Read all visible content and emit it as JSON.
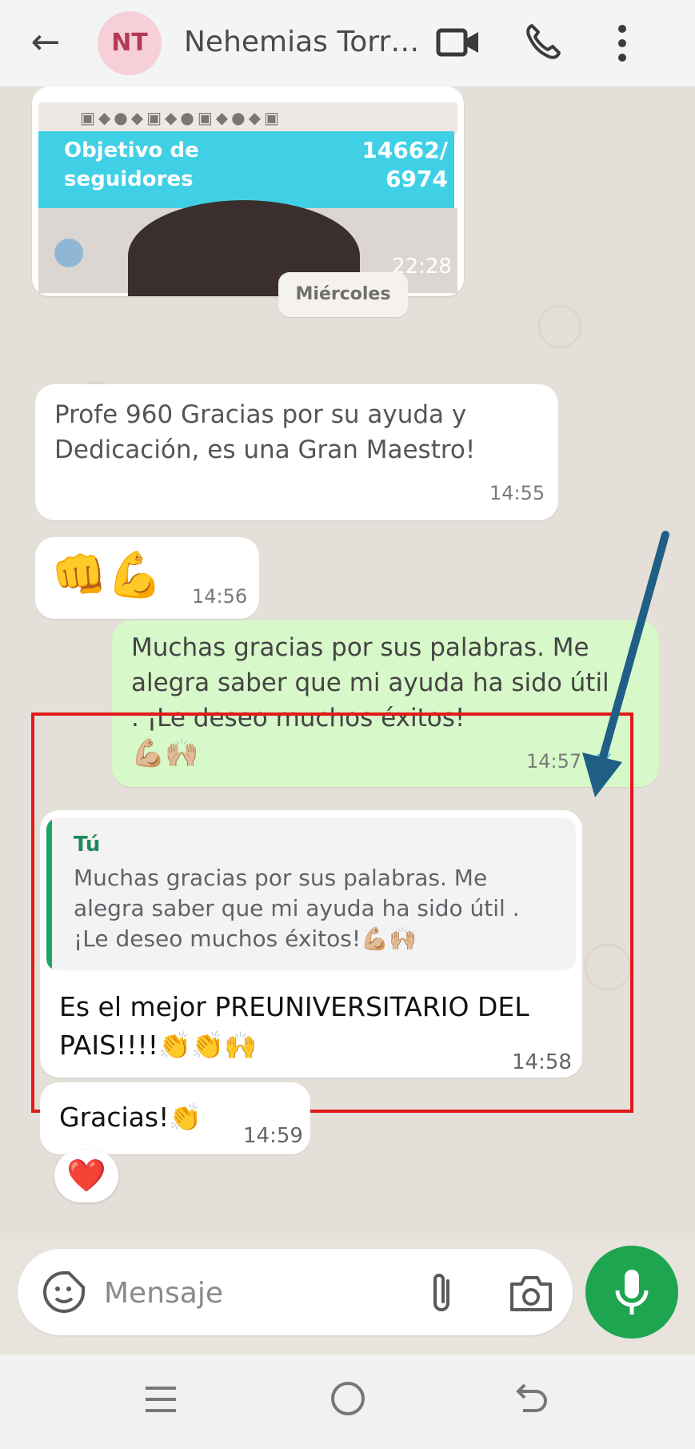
{
  "header": {
    "back_icon": "arrow-left-icon",
    "avatar_initials": "NT",
    "contact_name": "Nehemias Torr…",
    "video_icon": "video-camera-icon",
    "call_icon": "phone-icon",
    "more_icon": "more-vertical-icon"
  },
  "image_message": {
    "goal_label": "Objetivo de seguidores",
    "goal_value": "14662/ 6974",
    "time": "22:28"
  },
  "date_separator": "Miércoles",
  "messages": [
    {
      "direction": "incoming",
      "text": "Profe 960 Gracias por su ayuda y Dedicación, es una Gran Maestro!",
      "time": "14:55"
    },
    {
      "direction": "incoming",
      "text": "👊💪",
      "time": "14:56"
    },
    {
      "direction": "outgoing",
      "text": "Muchas gracias por sus palabras. Me alegra saber que mi ayuda ha sido útil . ¡Le deseo muchos éxitos!",
      "emoji": "💪🏼🙌🏼",
      "time": "14:57",
      "status": "read"
    },
    {
      "direction": "incoming",
      "quote_author": "Tú",
      "quote_text": "Muchas gracias por sus palabras. Me alegra saber que mi ayuda ha sido útil . ¡Le deseo muchos éxitos!💪🏼🙌🏼",
      "text": "Es el mejor PREUNIVERSITARIO DEL PAIS!!!!👏👏🙌",
      "time": "14:58"
    },
    {
      "direction": "incoming",
      "text": "Gracias!👏",
      "time": "14:59",
      "reaction": "❤️"
    }
  ],
  "composer": {
    "placeholder": "Mensaje",
    "emoji_icon": "sticker-icon",
    "attach_icon": "paperclip-icon",
    "camera_icon": "camera-icon",
    "mic_icon": "microphone-icon"
  },
  "colors": {
    "outgoing_bubble": "#d7f8c8",
    "incoming_bubble": "#ffffff",
    "mic_button": "#1da54f",
    "highlight_border": "#e11a1a",
    "annotation_arrow": "#1f5f86"
  }
}
